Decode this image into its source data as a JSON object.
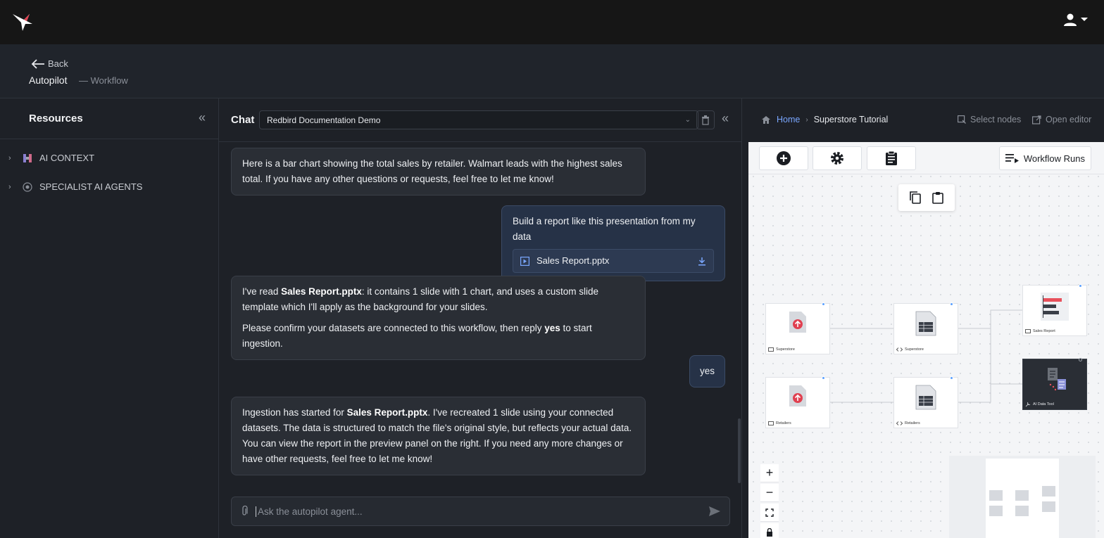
{
  "topbar": {
    "logo_icon": "hummingbird-logo",
    "user_icon": "user-icon"
  },
  "header": {
    "back_label": "Back",
    "title": "Autopilot",
    "subtitle": "— Workflow"
  },
  "resources": {
    "title": "Resources",
    "items": [
      {
        "label": "AI CONTEXT"
      },
      {
        "label": "SPECIALIST AI AGENTS"
      }
    ]
  },
  "chat": {
    "title": "Chat",
    "selected_conversation": "Redbird Documentation Demo",
    "messages": [
      {
        "role": "assistant",
        "p1": "Here is a bar chart showing the total sales by retailer. Walmart leads with the highest sales total. If you have any other questions or requests, feel free to let me know!"
      },
      {
        "role": "user",
        "text": "Build a report like this presentation from my data",
        "attachment": "Sales Report.pptx"
      },
      {
        "role": "assistant",
        "p1_pre": "I've read ",
        "p1_bold": "Sales Report.pptx",
        "p1_post": ": it contains 1 slide with 1 chart, and uses a custom slide template which I'll apply as the background for your slides.",
        "p2_pre": "Please confirm your datasets are connected to this workflow, then reply ",
        "p2_bold": "yes",
        "p2_post": " to start ingestion."
      },
      {
        "role": "user",
        "text": "yes"
      },
      {
        "role": "assistant",
        "p1_pre": "Ingestion has started for ",
        "p1_bold": "Sales Report.pptx",
        "p1_post": ". I've recreated 1 slide using your connected datasets. The data is structured to match the file's original style, but reflects your actual data. You can view the report in the preview panel on the right. If you need any more changes or have other requests, feel free to let me know!"
      }
    ],
    "input_placeholder": "Ask the autopilot agent..."
  },
  "workflow": {
    "breadcrumb_home": "Home",
    "breadcrumb_current": "Superstore Tutorial",
    "select_nodes": "Select nodes",
    "open_editor": "Open editor",
    "workflow_runs": "Workflow Runs",
    "nodes": [
      {
        "label": "Superstore",
        "kind": "upload"
      },
      {
        "label": "Superstore",
        "kind": "dataset"
      },
      {
        "label": "Sales Report",
        "kind": "report"
      },
      {
        "label": "Retailers",
        "kind": "upload"
      },
      {
        "label": "Retailers",
        "kind": "dataset"
      },
      {
        "label": "AI Data Tool",
        "kind": "ai-tool"
      }
    ],
    "colors": {
      "accent": "#7aa7ff",
      "upload_red": "#e04050",
      "report_red": "#e8505b"
    }
  }
}
